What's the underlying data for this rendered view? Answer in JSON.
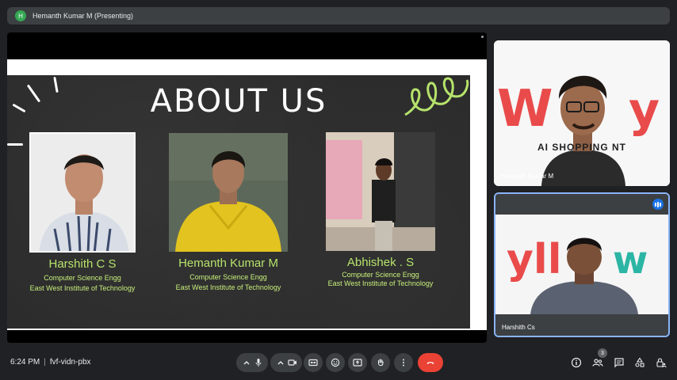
{
  "presenter_bar": {
    "avatar_letter": "H",
    "title": "Hemanth Kumar M (Presenting)"
  },
  "slide": {
    "title": "ABOUT US",
    "members": [
      {
        "name": "Harshith C S",
        "dept": "Computer Science Engg",
        "college": "East West Institute of Technology"
      },
      {
        "name": "Hemanth Kumar M",
        "dept": "Computer Science Engg",
        "college": "East West Institute of Technology"
      },
      {
        "name": "Abhishek . S",
        "dept": "Computer Science Engg",
        "college": "East West Institute of Technology"
      }
    ]
  },
  "participants": [
    {
      "name": "Hemanth Kumar M",
      "bg_text": "AI SHOPPING  NT"
    },
    {
      "name": "Harshith Cs",
      "speaking": true
    }
  ],
  "footer": {
    "time": "6:24 PM",
    "separator": "|",
    "meeting_code": "fvf-vidn-pbx",
    "people_count": "3"
  },
  "colors": {
    "accent": "#8ab4f8",
    "hangup": "#ea4335",
    "chalk_green": "#b6e36b",
    "bar_bg": "#3c4043"
  }
}
